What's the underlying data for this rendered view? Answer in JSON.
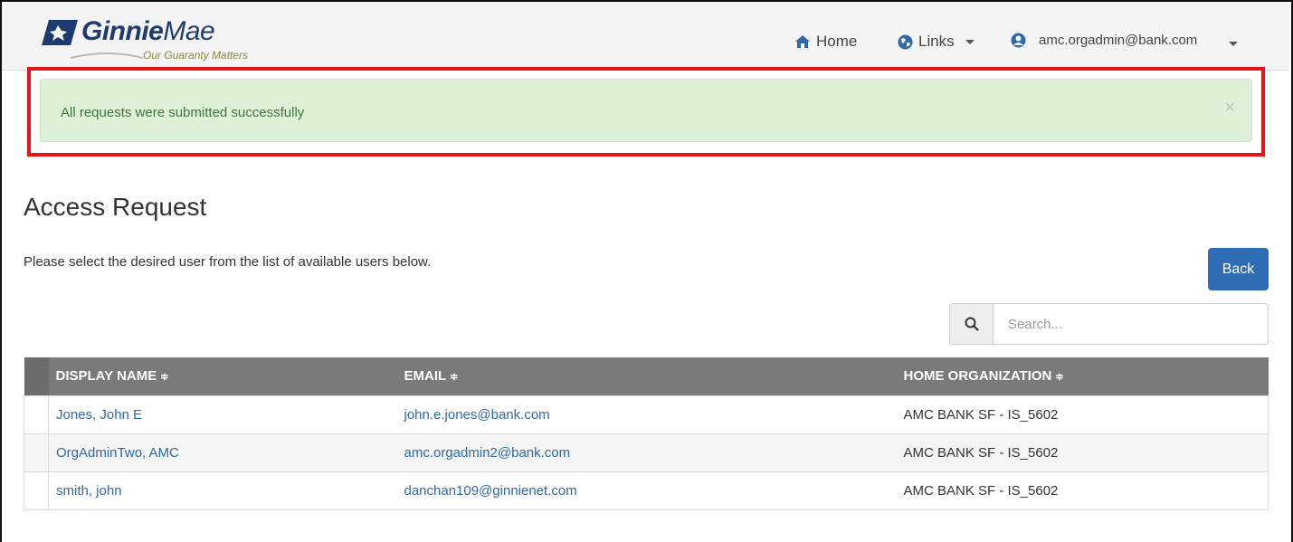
{
  "header": {
    "brand_bold": "Ginnie",
    "brand_light": "Mae",
    "tagline": "Our Guaranty Matters",
    "nav_home": "Home",
    "nav_links": "Links",
    "user_email": "amc.orgadmin@bank.com"
  },
  "alert": {
    "message": "All requests were submitted successfully",
    "close": "×"
  },
  "page": {
    "title": "Access Request",
    "subtitle": "Please select the desired user from the list of available users below.",
    "back_label": "Back"
  },
  "search": {
    "placeholder": "Search..."
  },
  "table": {
    "headers": [
      "DISPLAY NAME",
      "EMAIL",
      "HOME ORGANIZATION"
    ],
    "sort_symbol": "≑",
    "rows": [
      {
        "name": "Jones, John E",
        "email": "john.e.jones@bank.com",
        "org": "AMC BANK SF - IS_5602"
      },
      {
        "name": "OrgAdminTwo, AMC",
        "email": "amc.orgadmin2@bank.com",
        "org": "AMC BANK SF - IS_5602"
      },
      {
        "name": "smith, john",
        "email": "danchan109@ginnienet.com",
        "org": "AMC BANK SF - IS_5602"
      }
    ]
  },
  "colors": {
    "navy": "#1d3b6e",
    "alert_bg": "#dff0d8",
    "alert_text": "#3c763d",
    "highlight_border": "#e8121b",
    "primary_button": "#2f6db5",
    "table_header": "#7a7a7a",
    "link": "#2d6aa9"
  },
  "icons": {
    "home": "home-icon",
    "links": "globe-icon",
    "user": "user-circle-icon",
    "search": "search-icon"
  }
}
